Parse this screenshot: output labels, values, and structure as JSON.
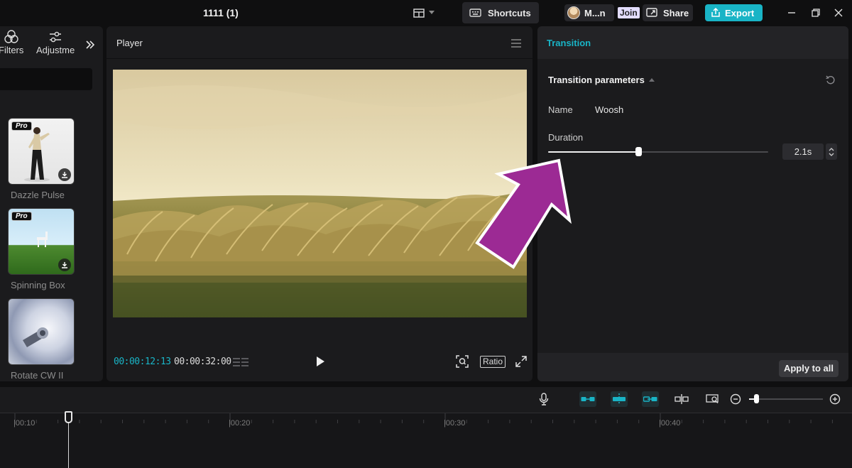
{
  "titlebar": {
    "project_title": "1111 (1)",
    "shortcuts_label": "Shortcuts",
    "user_name": "M...n",
    "join_label": "Join",
    "share_label": "Share",
    "export_label": "Export"
  },
  "left_panel": {
    "tabs": [
      {
        "label": "Filters",
        "icon": "filters-icon"
      },
      {
        "label": "Adjustme",
        "icon": "adjustment-icon"
      }
    ],
    "items": [
      {
        "label": "Dazzle Pulse",
        "badge": "Pro"
      },
      {
        "label": "Spinning Box",
        "badge": "Pro"
      },
      {
        "label": "Rotate CW II"
      }
    ]
  },
  "player": {
    "title": "Player",
    "current_time": "00:00:12:13",
    "total_time": "00:00:32:00",
    "ratio_label": "Ratio"
  },
  "right_panel": {
    "tab": "Transition",
    "section_title": "Transition parameters",
    "name_label": "Name",
    "name_value": "Woosh",
    "duration_label": "Duration",
    "duration_value": "2.1s",
    "duration_slider_fraction": 0.41,
    "apply_all_label": "Apply to all"
  },
  "timeline": {
    "ruler_labels": [
      "|00:10",
      "|00:20",
      "|00:30",
      "|00:40"
    ],
    "zoom_fraction": 0.1
  },
  "colors": {
    "accent": "#19b4c6",
    "annotation_arrow": "#9c2a94"
  }
}
